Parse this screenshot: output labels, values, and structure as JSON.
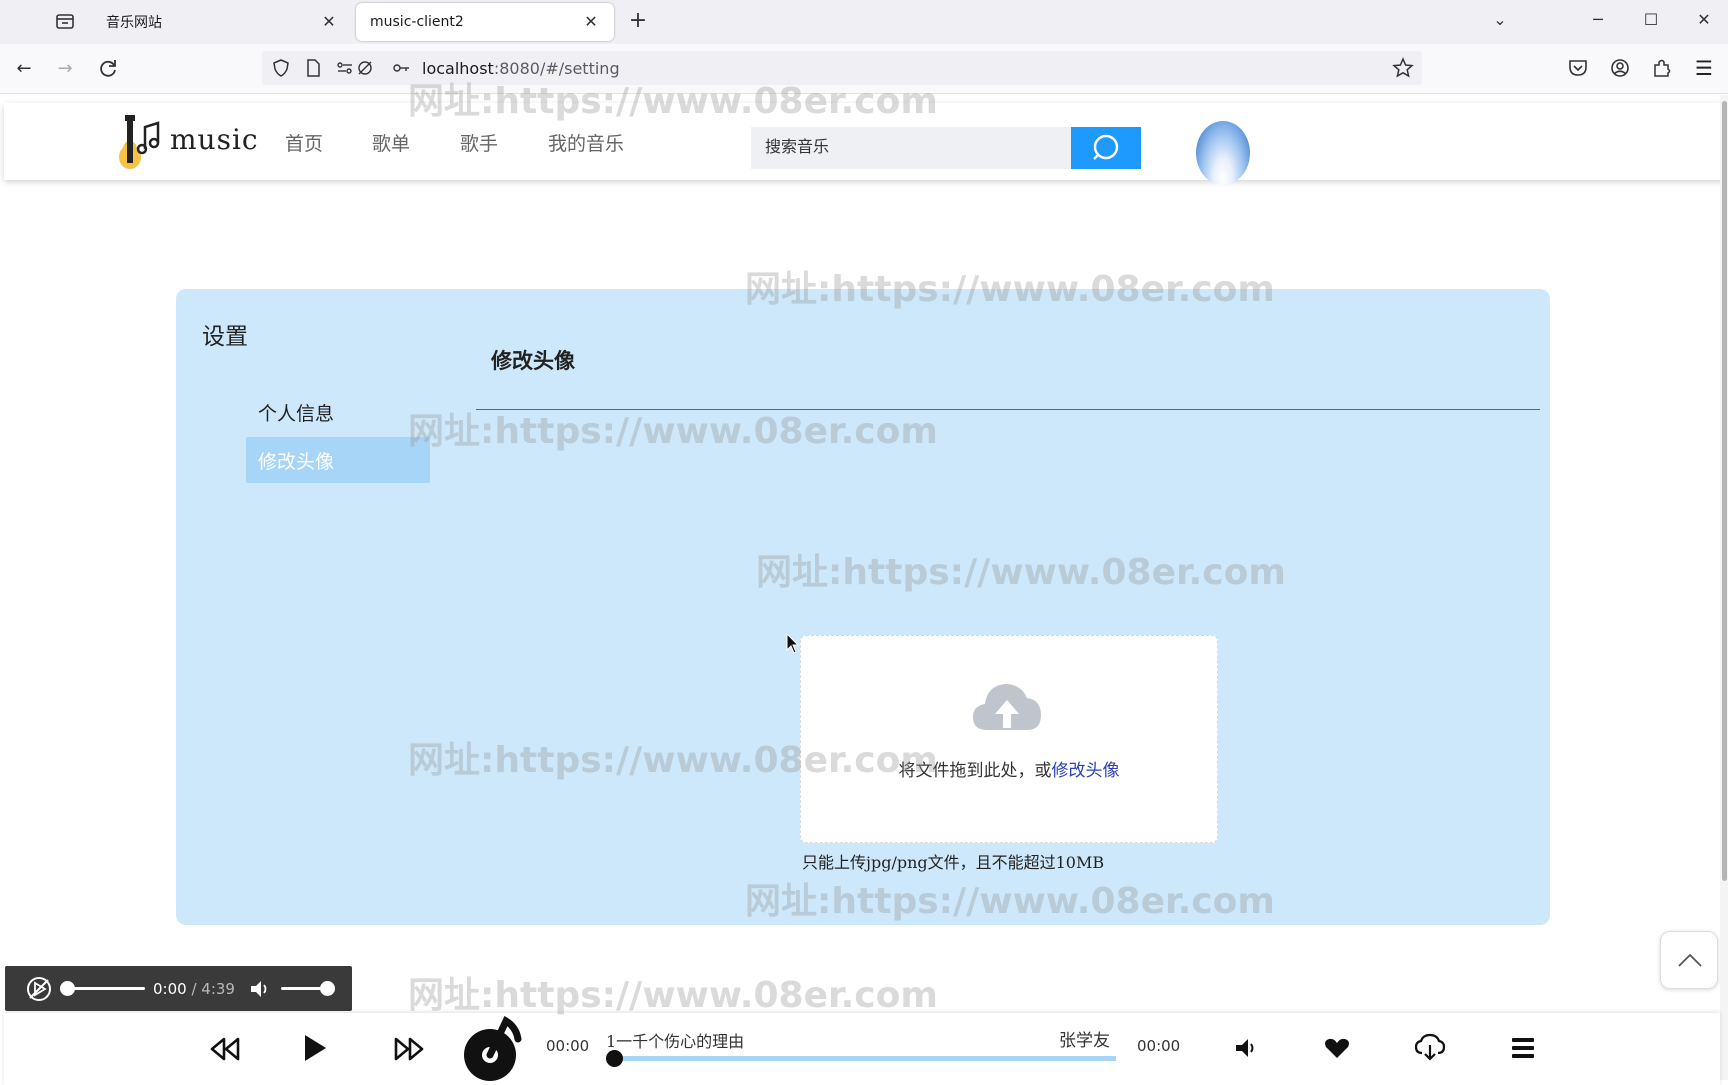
{
  "browser": {
    "tabs": [
      {
        "title": "音乐网站",
        "active": false
      },
      {
        "title": "music-client2",
        "active": true
      }
    ],
    "url_host": "localhost",
    "url_rest": ":8080/#/setting"
  },
  "header": {
    "logo_text": "music",
    "nav": [
      "首页",
      "歌单",
      "歌手",
      "我的音乐"
    ],
    "search_placeholder": "搜索音乐"
  },
  "settings": {
    "title": "设置",
    "menu": [
      {
        "label": "个人信息",
        "active": false
      },
      {
        "label": "修改头像",
        "active": true
      }
    ],
    "section_title": "修改头像",
    "upload_text": "将文件拖到此处，或",
    "upload_link": "修改头像",
    "upload_tip": "只能上传jpg/png文件，且不能超过10MB"
  },
  "audio_control": {
    "current": "0:00",
    "total": "/ 4:39"
  },
  "player": {
    "current_time": "00:00",
    "duration": "00:00",
    "song_title": "1一千个伤心的理由",
    "artist": "张学友",
    "progress": 0
  },
  "watermark": "网址:https://www.08er.com",
  "colors": {
    "accent": "#1e9aff",
    "card_bg": "#cde8fb",
    "menu_active": "#a6d5f8",
    "link": "#2a3fb8"
  }
}
